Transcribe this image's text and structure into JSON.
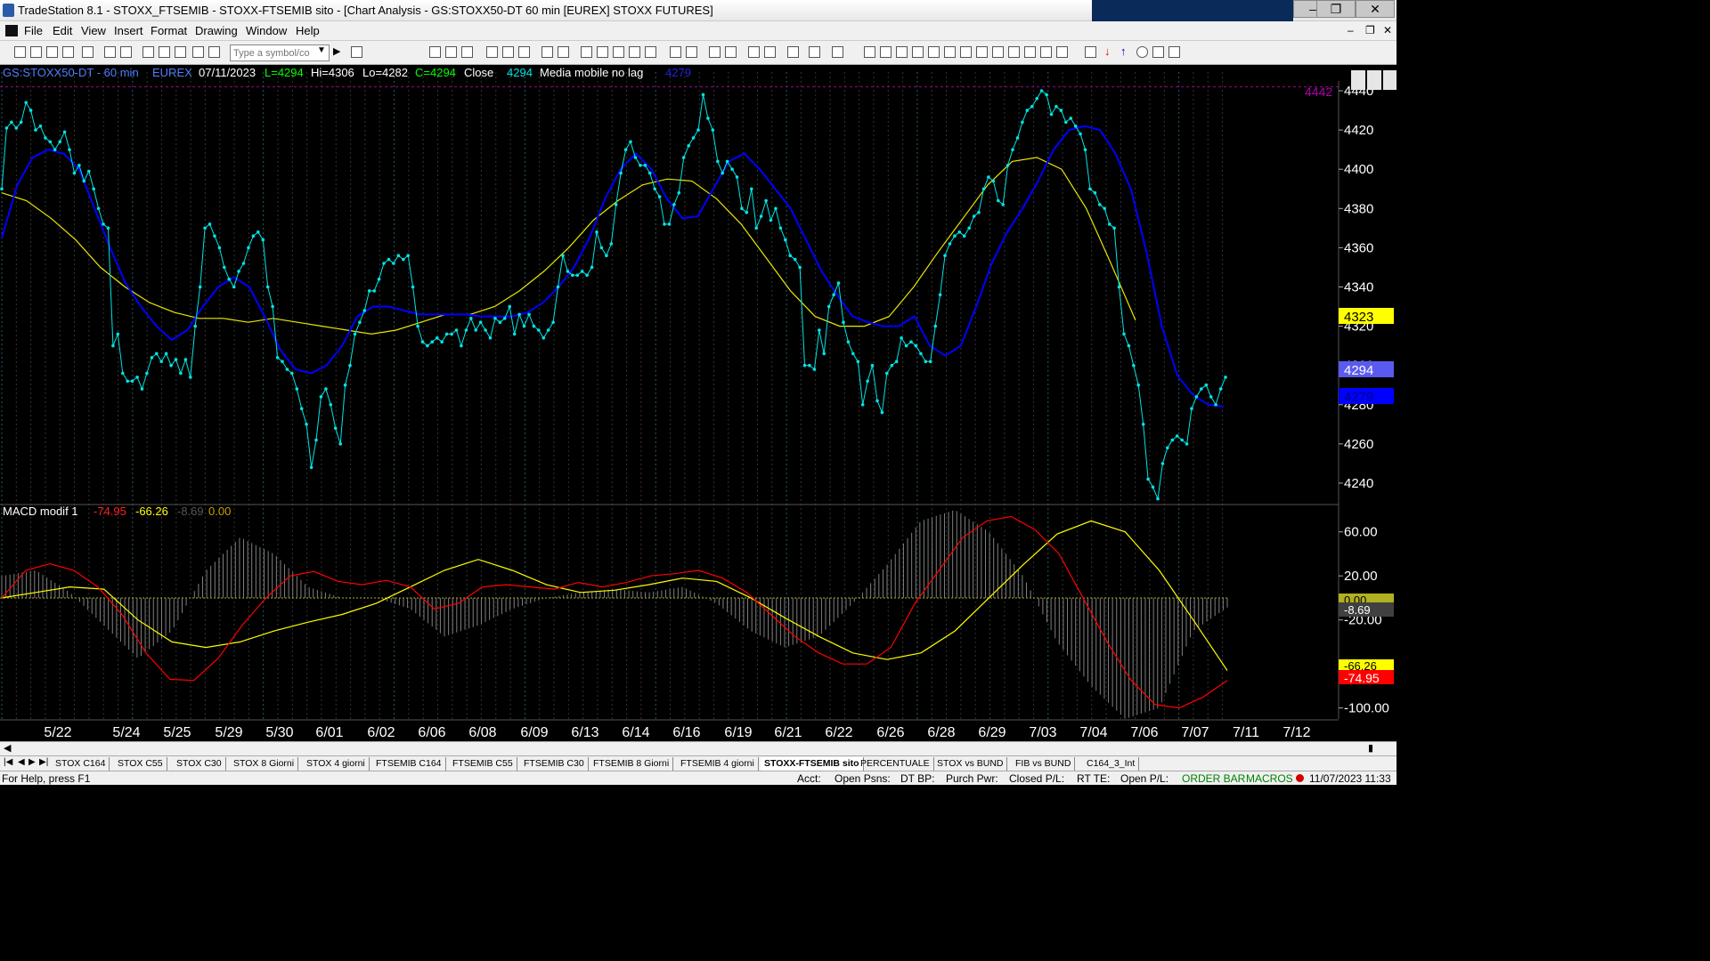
{
  "window": {
    "title": "TradeStation 8.1 - STOXX_FTSEMIB - STOXX-FTSEMIB sito - [Chart Analysis - GS:STOXX50-DT  60 min  [EUREX] STOXX FUTURES]",
    "min_icon": "minimize-icon",
    "max_icon": "maximize-icon",
    "close_icon": "close-icon"
  },
  "menu": [
    "File",
    "Edit",
    "View",
    "Insert",
    "Format",
    "Drawing",
    "Window",
    "Help"
  ],
  "toolbar": {
    "symbol_placeholder": "Type a symbol/co"
  },
  "chart_header": {
    "symbol": "GS:STOXX50-DT - 60 min",
    "exchange": "EUREX",
    "date": "07/11/2023",
    "last": "L=4294",
    "high": "Hi=4306",
    "low": "Lo=4282",
    "close": "C=4294",
    "series1_name": "Close",
    "series1_value": "4294",
    "series2_name": "Media mobile no lag",
    "series2_value": "4279"
  },
  "macd_header": {
    "name": "MACD modif 1",
    "v1": "-74.95",
    "v2": "-66.26",
    "v3": "-8.69",
    "v4": "0.00"
  },
  "price_tags": {
    "top": "4442",
    "yellow": "4323",
    "blue_light": "4294",
    "blue": "4279"
  },
  "macd_tags": {
    "zero": "0.00",
    "hist": "-8.69",
    "signal": "-66.26",
    "macd": "-74.95"
  },
  "colors": {
    "price": "#00e5e5",
    "fast_ma": "#0000ff",
    "slow_ma": "#e8e800",
    "macd_line": "#ff0000",
    "signal_line": "#ffff00",
    "histogram": "#808080",
    "header_symbol": "#4f7fff",
    "header_green": "#00ff00",
    "axis_text": "#ffffff"
  },
  "x_labels": [
    "5/22",
    "5/24",
    "5/25",
    "5/29",
    "5/30",
    "6/01",
    "6/02",
    "6/06",
    "6/08",
    "6/09",
    "6/13",
    "6/14",
    "6/16",
    "6/19",
    "6/21",
    "6/22",
    "6/26",
    "6/28",
    "6/29",
    "7/03",
    "7/04",
    "7/06",
    "7/07",
    "7/11",
    "7/12"
  ],
  "chart_data": [
    {
      "type": "line",
      "panel": "price",
      "title": "GS:STOXX50-DT - 60 min",
      "x_unit": "hourly bar index (~9 bars per session)",
      "ylim": [
        4230,
        4445
      ],
      "y_ticks": [
        4240,
        4260,
        4280,
        4300,
        4320,
        4340,
        4360,
        4380,
        4400,
        4420,
        4440
      ],
      "reference_line": 4442,
      "series": [
        {
          "name": "Close",
          "values": [
            4390,
            4421,
            4424,
            4421,
            4424,
            4434,
            4430,
            4420,
            4422,
            4416,
            4414,
            4410,
            4414,
            4419,
            4410,
            4398,
            4402,
            4394,
            4399,
            4390,
            4380,
            4372,
            4370,
            4310,
            4316,
            4296,
            4292,
            4292,
            4294,
            4288,
            4296,
            4304,
            4306,
            4302,
            4306,
            4300,
            4303,
            4296,
            4303,
            4294,
            4320,
            4340,
            4370,
            4372,
            4366,
            4360,
            4350,
            4344,
            4340,
            4348,
            4352,
            4360,
            4366,
            4368,
            4364,
            4340,
            4330,
            4304,
            4302,
            4298,
            4296,
            4288,
            4278,
            4270,
            4248,
            4262,
            4284,
            4288,
            4280,
            4268,
            4260,
            4290,
            4300,
            4316,
            4322,
            4328,
            4338,
            4338,
            4344,
            4352,
            4354,
            4352,
            4356,
            4354,
            4356,
            4340,
            4320,
            4312,
            4310,
            4312,
            4314,
            4312,
            4316,
            4316,
            4318,
            4310,
            4318,
            4324,
            4318,
            4322,
            4318,
            4314,
            4324,
            4322,
            4324,
            4330,
            4316,
            4326,
            4320,
            4326,
            4320,
            4318,
            4314,
            4318,
            4322,
            4340,
            4356,
            4348,
            4346,
            4346,
            4348,
            4346,
            4350,
            4368,
            4360,
            4356,
            4362,
            4382,
            4398,
            4410,
            4414,
            4406,
            4402,
            4402,
            4398,
            4390,
            4386,
            4372,
            4372,
            4382,
            4388,
            4406,
            4412,
            4416,
            4420,
            4438,
            4426,
            4420,
            4404,
            4398,
            4404,
            4400,
            4396,
            4380,
            4378,
            4390,
            4370,
            4376,
            4384,
            4374,
            4380,
            4370,
            4364,
            4356,
            4354,
            4350,
            4300,
            4300,
            4298,
            4318,
            4306,
            4330,
            4336,
            4342,
            4322,
            4312,
            4306,
            4302,
            4280,
            4292,
            4300,
            4282,
            4276,
            4296,
            4300,
            4302,
            4314,
            4310,
            4312,
            4310,
            4306,
            4302,
            4302,
            4320,
            4336,
            4356,
            4362,
            4366,
            4368,
            4366,
            4370,
            4376,
            4378,
            4390,
            4396,
            4394,
            4384,
            4382,
            4402,
            4410,
            4416,
            4424,
            4430,
            4432,
            4436,
            4440,
            4438,
            4428,
            4432,
            4430,
            4424,
            4426,
            4422,
            4418,
            4410,
            4390,
            4388,
            4382,
            4380,
            4372,
            4370,
            4340,
            4316,
            4310,
            4300,
            4290,
            4270,
            4242,
            4238,
            4232,
            4250,
            4258,
            4262,
            4264,
            4262,
            4260,
            4278,
            4284,
            4288,
            4290,
            4284,
            4280,
            4288,
            4294
          ]
        },
        {
          "name": "Media mobile no lag",
          "values": [
            4365,
            4392,
            4406,
            4410,
            4408,
            4400,
            4380,
            4360,
            4342,
            4330,
            4320,
            4313,
            4318,
            4330,
            4340,
            4345,
            4340,
            4325,
            4308,
            4298,
            4296,
            4300,
            4310,
            4325,
            4330,
            4330,
            4328,
            4326,
            4326,
            4326,
            4326,
            4325,
            4325,
            4325,
            4327,
            4332,
            4340,
            4350,
            4365,
            4385,
            4400,
            4408,
            4400,
            4385,
            4375,
            4376,
            4390,
            4404,
            4408,
            4400,
            4390,
            4380,
            4364,
            4348,
            4336,
            4325,
            4322,
            4320,
            4320,
            4325,
            4310,
            4305,
            4310,
            4330,
            4352,
            4368,
            4380,
            4394,
            4410,
            4420,
            4422,
            4420,
            4408,
            4390,
            4358,
            4320,
            4295,
            4285,
            4280,
            4279
          ]
        },
        {
          "name": "slow average",
          "values": [
            4388,
            4384,
            4375,
            4364,
            4350,
            4340,
            4332,
            4327,
            4324,
            4324,
            4322,
            4324,
            4322,
            4320,
            4318,
            4316,
            4318,
            4322,
            4326,
            4326,
            4330,
            4338,
            4348,
            4360,
            4374,
            4384,
            4392,
            4395,
            4394,
            4385,
            4372,
            4355,
            4338,
            4325,
            4320,
            4320,
            4325,
            4340,
            4358,
            4375,
            4392,
            4404,
            4406,
            4400,
            4380,
            4352,
            4323
          ]
        }
      ]
    },
    {
      "type": "line",
      "panel": "macd",
      "title": "MACD modif 1",
      "ylim": [
        -110,
        80
      ],
      "y_ticks": [
        60,
        20,
        0,
        -20,
        -60,
        -100
      ],
      "y_tick_labels": [
        "60.00",
        "20.00",
        "0.00",
        "-20.00",
        "-60.00",
        "-100.00"
      ],
      "series": [
        {
          "name": "macd",
          "values": [
            0,
            25,
            31,
            25,
            10,
            -15,
            -50,
            -74,
            -75,
            -55,
            -25,
            0,
            20,
            24,
            15,
            12,
            16,
            10,
            -10,
            -5,
            10,
            12,
            10,
            8,
            14,
            10,
            14,
            20,
            22,
            25,
            18,
            5,
            -15,
            -35,
            -50,
            -60,
            -60,
            -45,
            -5,
            25,
            55,
            70,
            74,
            62,
            40,
            0,
            -40,
            -75,
            -97,
            -100,
            -90,
            -75
          ]
        },
        {
          "name": "signal",
          "values": [
            0,
            5,
            10,
            8,
            -20,
            -40,
            -45,
            -40,
            -30,
            -22,
            -15,
            -5,
            10,
            25,
            35,
            25,
            12,
            5,
            7,
            12,
            18,
            15,
            0,
            -18,
            -35,
            -50,
            -56,
            -50,
            -30,
            0,
            30,
            58,
            70,
            60,
            25,
            -20,
            -66
          ]
        },
        {
          "name": "histogram",
          "values": [
            20,
            25,
            5,
            -25,
            -55,
            -30,
            25,
            55,
            40,
            10,
            0,
            0,
            -10,
            -35,
            -25,
            -10,
            0,
            5,
            8,
            5,
            10,
            -5,
            -30,
            -45,
            -35,
            -5,
            30,
            70,
            80,
            60,
            20,
            -40,
            -80,
            -110,
            -100,
            -30,
            -8.69
          ]
        }
      ]
    }
  ],
  "tabs": [
    "STOX C164",
    "STOX C55",
    "STOX  C30",
    "STOX  8 Giorni",
    "STOX 4 giorni",
    "FTSEMIB C164",
    "FTSEMIB C55",
    "FTSEMIB C30",
    "FTSEMIB  8 Giorni",
    "FTSEMIB  4 giorni",
    "STOXX-FTSEMIB sito",
    "PERCENTUALE",
    "STOX vs BUND",
    "FIB vs BUND",
    "C164_3_Int"
  ],
  "active_tab": "STOXX-FTSEMIB sito",
  "status_bar": {
    "help": "For Help, press F1",
    "acct": "Acct:",
    "open_psns": "Open Psns:",
    "dt_bp": "DT BP:",
    "purch_pwr": "Purch Pwr:",
    "closed_pl": "Closed P/L:",
    "rt_te": "RT TE:",
    "open_pl": "Open P/L:",
    "order_bar": "ORDER BAR",
    "macros": "MACROS",
    "datetime": "11/07/2023 11:33"
  }
}
